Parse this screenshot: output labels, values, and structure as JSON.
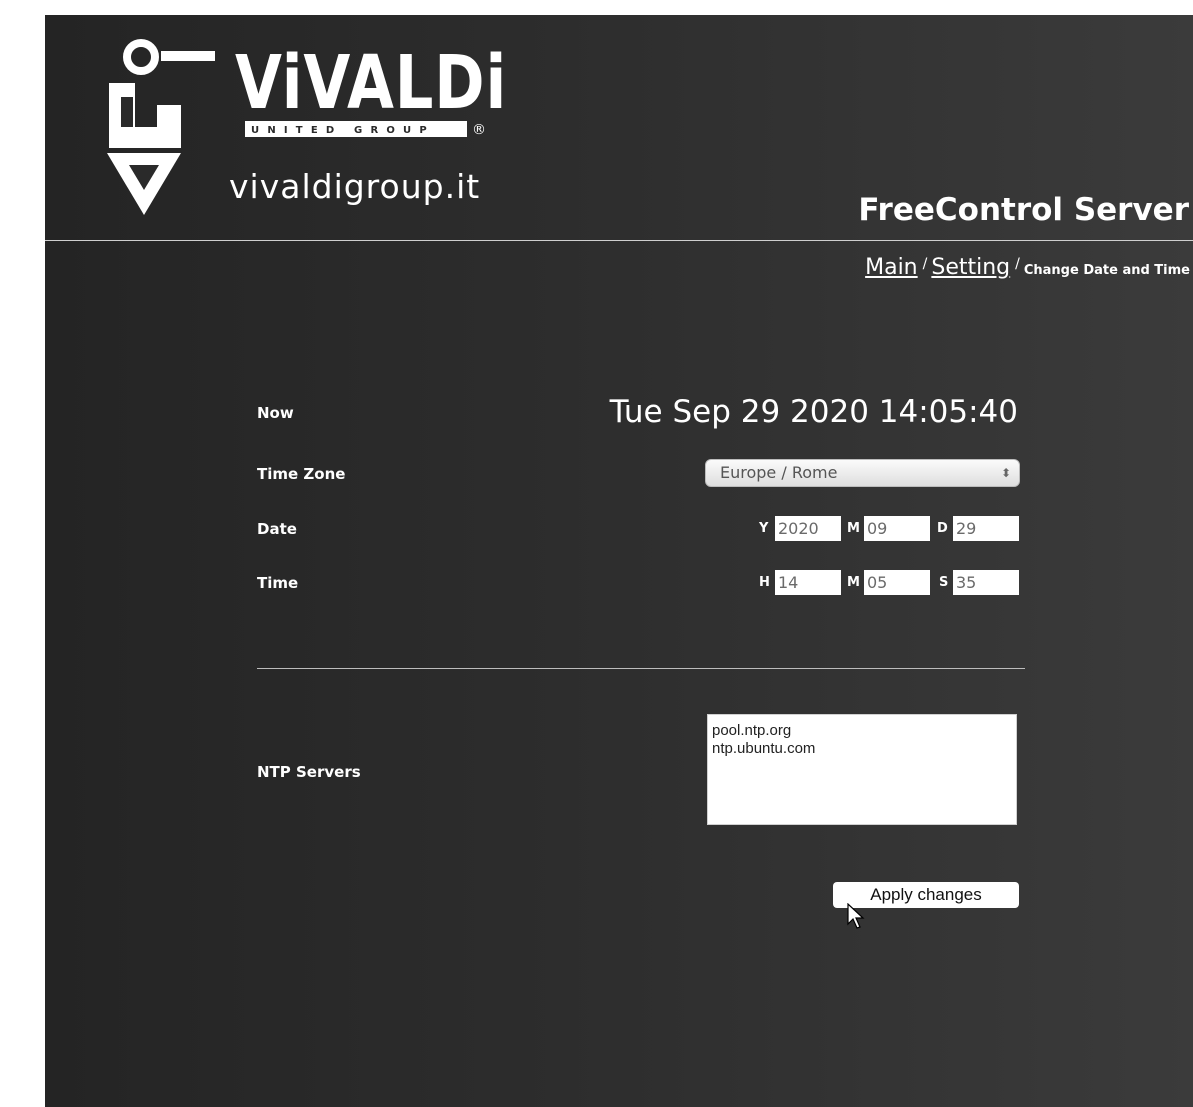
{
  "header": {
    "brand_name": "ViVALDi",
    "brand_tagline": "UNITED GROUP",
    "brand_registered": "®",
    "brand_domain": "vivaldigroup.it",
    "product_title": "FreeControl Server"
  },
  "breadcrumb": {
    "items": [
      {
        "label": "Main"
      },
      {
        "label": "Setting"
      }
    ],
    "separator": "/",
    "current": "Change Date and Time"
  },
  "form": {
    "now": {
      "label": "Now",
      "value": "Tue Sep 29 2020 14:05:40"
    },
    "timezone": {
      "label": "Time Zone",
      "value": "Europe / Rome"
    },
    "date": {
      "label": "Date",
      "year": {
        "label": "Y",
        "value": "2020"
      },
      "month": {
        "label": "M",
        "value": "09"
      },
      "day": {
        "label": "D",
        "value": "29"
      }
    },
    "time": {
      "label": "Time",
      "hour": {
        "label": "H",
        "value": "14"
      },
      "minute": {
        "label": "M",
        "value": "05"
      },
      "second": {
        "label": "S",
        "value": "35"
      }
    },
    "ntp": {
      "label": "NTP Servers",
      "servers": [
        "pool.ntp.org",
        "ntp.ubuntu.com"
      ]
    },
    "apply_label": "Apply changes"
  },
  "icons": {
    "logo": "vivaldi-logo-icon",
    "select_arrows": "up-down-arrows-icon",
    "cursor": "mouse-pointer-icon"
  },
  "colors": {
    "background_dark": "#242424",
    "background_light": "#3b3b3b",
    "text": "#ffffff"
  }
}
